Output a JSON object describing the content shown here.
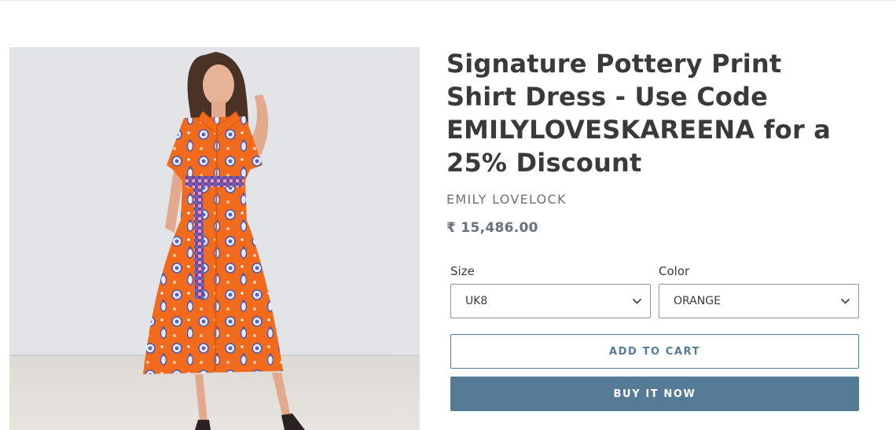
{
  "product": {
    "title": "Signature Pottery Print Shirt Dress - Use Code EMILYLOVESKAREENA for a 25% Discount",
    "vendor": "EMILY LOVELOCK",
    "price": "₹ 15,486.00",
    "image_alt": "Woman wearing an orange shirt dress with blue pottery print and a patterned belt"
  },
  "variants": {
    "size": {
      "label": "Size",
      "value": "UK8"
    },
    "color": {
      "label": "Color",
      "value": "ORANGE"
    }
  },
  "actions": {
    "add_to_cart": "ADD TO CART",
    "buy_now": "BUY IT NOW"
  },
  "colors": {
    "accent": "#557b97",
    "text": "#3a3a3a",
    "muted": "#69727b",
    "dress": "#f26a1b"
  }
}
